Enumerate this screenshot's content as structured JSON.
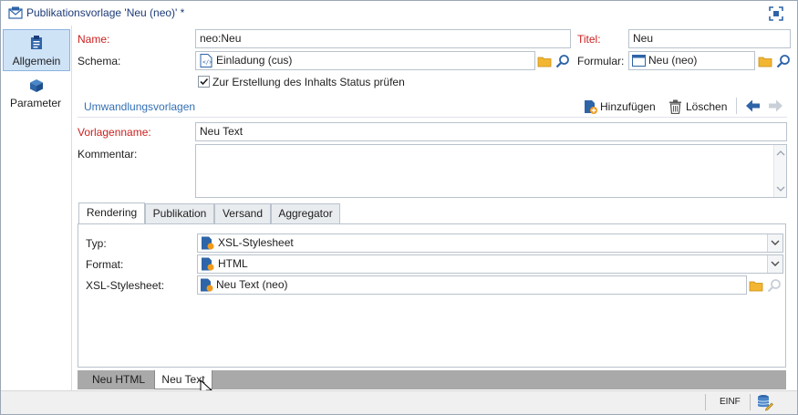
{
  "window": {
    "title": "Publikationsvorlage 'Neu (neo)' *",
    "accent": "#3470b5",
    "required_label_color": "#cc1f1f"
  },
  "sidebar": {
    "items": [
      {
        "label": "Allgemein",
        "icon": "clipboard-icon",
        "active": true
      },
      {
        "label": "Parameter",
        "icon": "cube-icon",
        "active": false
      }
    ]
  },
  "form": {
    "name_label": "Name:",
    "name_value": "neo:Neu",
    "title_label": "Titel:",
    "title_value": "Neu",
    "schema_label": "Schema:",
    "schema_value": "Einladung (cus)",
    "formular_label": "Formular:",
    "formular_value": "Neu (neo)",
    "status_checkbox_label": "Zur Erstellung des Inhalts Status prüfen",
    "status_checkbox_checked": true
  },
  "section": {
    "title": "Umwandlungsvorlagen",
    "add_label": "Hinzufügen",
    "delete_label": "Löschen"
  },
  "template": {
    "name_label": "Vorlagenname:",
    "name_value": "Neu Text",
    "comment_label": "Kommentar:",
    "comment_value": ""
  },
  "tabs": [
    {
      "label": "Rendering",
      "active": true
    },
    {
      "label": "Publikation",
      "active": false
    },
    {
      "label": "Versand",
      "active": false
    },
    {
      "label": "Aggregator",
      "active": false
    }
  ],
  "rendering": {
    "type_label": "Typ:",
    "type_value": "XSL-Stylesheet",
    "format_label": "Format:",
    "format_value": "HTML",
    "xsl_label": "XSL-Stylesheet:",
    "xsl_value": "Neu Text (neo)"
  },
  "bottom_tabs": [
    {
      "label": "Neu HTML",
      "active": false
    },
    {
      "label": "Neu Text",
      "active": true
    }
  ],
  "status": {
    "mode": "EINF"
  }
}
